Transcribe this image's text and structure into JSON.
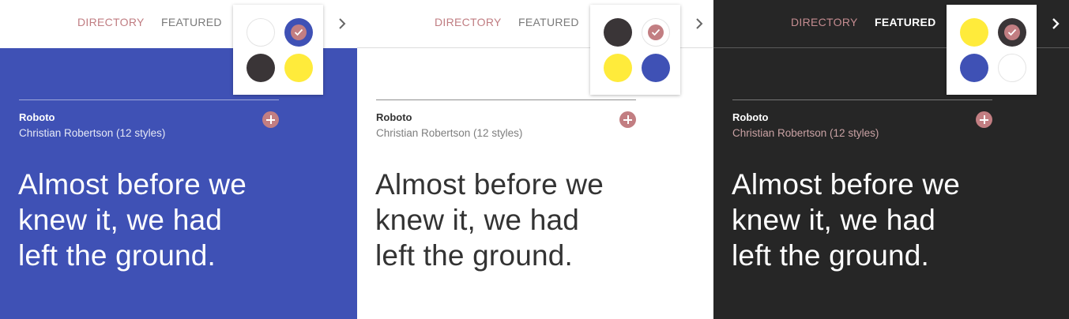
{
  "panels": [
    {
      "theme": "blue",
      "nav": {
        "directory": "DIRECTORY",
        "featured": "FEATURED",
        "next_icon": "chevron-right-icon"
      },
      "card": {
        "font_name": "Roboto",
        "author": "Christian Robertson (12 styles)",
        "sample_lines": [
          "Almost before we",
          "knew it, we had",
          "left the ground."
        ],
        "add_icon": "plus-icon"
      },
      "color_picker": {
        "swatches": [
          {
            "name": "white",
            "color": "#ffffff",
            "selected": false
          },
          {
            "name": "blue",
            "color": "#3f51b5",
            "selected": true
          },
          {
            "name": "dark",
            "color": "#3a3537",
            "selected": false
          },
          {
            "name": "yellow",
            "color": "#ffeb3b",
            "selected": false
          }
        ]
      }
    },
    {
      "theme": "white",
      "nav": {
        "directory": "DIRECTORY",
        "featured": "FEATURED",
        "next_icon": "chevron-right-icon"
      },
      "card": {
        "font_name": "Roboto",
        "author": "Christian Robertson (12 styles)",
        "sample_lines": [
          "Almost before we",
          "knew it, we had",
          "left the ground."
        ],
        "add_icon": "plus-icon"
      },
      "color_picker": {
        "swatches": [
          {
            "name": "dark",
            "color": "#3a3537",
            "selected": false
          },
          {
            "name": "white",
            "color": "#ffffff",
            "selected": true
          },
          {
            "name": "yellow",
            "color": "#ffeb3b",
            "selected": false
          },
          {
            "name": "blue",
            "color": "#3f51b5",
            "selected": false
          }
        ]
      }
    },
    {
      "theme": "dark",
      "nav": {
        "directory": "DIRECTORY",
        "featured": "FEATURED",
        "next_icon": "chevron-right-icon"
      },
      "card": {
        "font_name": "Roboto",
        "author": "Christian Robertson (12 styles)",
        "sample_lines": [
          "Almost before we",
          "knew it, we had",
          "left the ground."
        ],
        "add_icon": "plus-icon"
      },
      "color_picker": {
        "swatches": [
          {
            "name": "yellow",
            "color": "#ffeb3b",
            "selected": false
          },
          {
            "name": "dark",
            "color": "#3a3537",
            "selected": true
          },
          {
            "name": "blue",
            "color": "#3f51b5",
            "selected": false
          },
          {
            "name": "white",
            "color": "#ffffff",
            "selected": false
          }
        ]
      }
    }
  ],
  "colors": {
    "accent": "#c27e82",
    "blue": "#3f51b5",
    "dark": "#262626",
    "yellow": "#ffeb3b"
  }
}
